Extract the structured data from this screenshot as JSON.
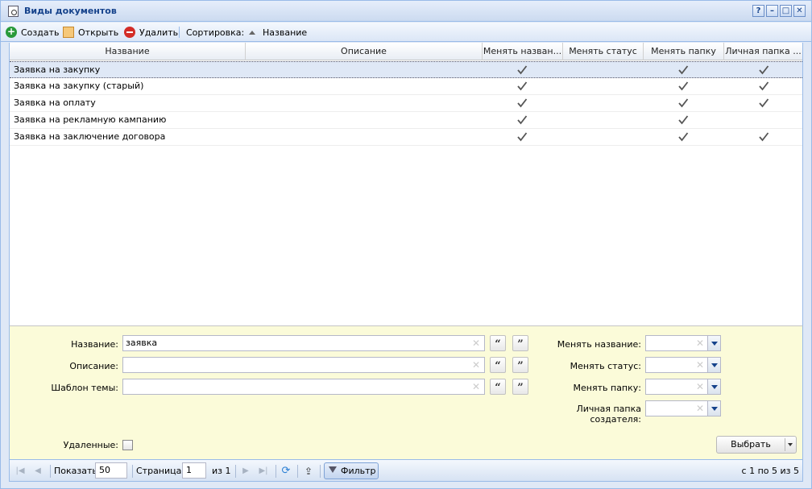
{
  "window": {
    "title": "Виды документов",
    "tools": [
      "?",
      "–",
      "□",
      "✕"
    ]
  },
  "toolbar": {
    "create_label": "Создать",
    "open_label": "Открыть",
    "delete_label": "Удалить",
    "sort_label": "Сортировка:",
    "sort_field": "Название"
  },
  "grid": {
    "columns": [
      "Название",
      "Описание",
      "Менять назван...",
      "Менять статус",
      "Менять папку",
      "Личная папка ..."
    ],
    "rows": [
      {
        "name": "Заявка на закупку",
        "description": "",
        "checks": [
          true,
          false,
          true,
          true
        ]
      },
      {
        "name": "Заявка на закупку (старый)",
        "description": "",
        "checks": [
          true,
          false,
          true,
          true
        ]
      },
      {
        "name": "Заявка на оплату",
        "description": "",
        "checks": [
          true,
          false,
          true,
          true
        ]
      },
      {
        "name": "Заявка на рекламную кампанию",
        "description": "",
        "checks": [
          true,
          false,
          true,
          false
        ]
      },
      {
        "name": "Заявка на заключение договора",
        "description": "",
        "checks": [
          true,
          false,
          true,
          true
        ]
      }
    ]
  },
  "filter": {
    "name_label": "Название:",
    "name_value": "заявка",
    "description_label": "Описание:",
    "description_value": "",
    "template_label": "Шаблон темы:",
    "template_value": "",
    "quote_open": "“",
    "quote_close": "”",
    "change_name_label": "Менять название:",
    "change_status_label": "Менять статус:",
    "change_folder_label": "Менять папку:",
    "personal_folder_label_1": "Личная папка",
    "personal_folder_label_2": "создателя:",
    "deleted_label": "Удаленные:",
    "select_button": "Выбрать"
  },
  "pager": {
    "show_label": "Показать",
    "page_size": "50",
    "page_label": "Страница",
    "page_value": "1",
    "of_label": "из 1",
    "filter_button": "Фильтр",
    "summary": "с 1 по 5 из 5"
  },
  "colors": {
    "header_text": "#15428b",
    "panel_border": "#99bbe8",
    "filter_bg": "#fbfbd9",
    "create_icon": "#2a9a3a",
    "delete_icon": "#d32d27"
  }
}
